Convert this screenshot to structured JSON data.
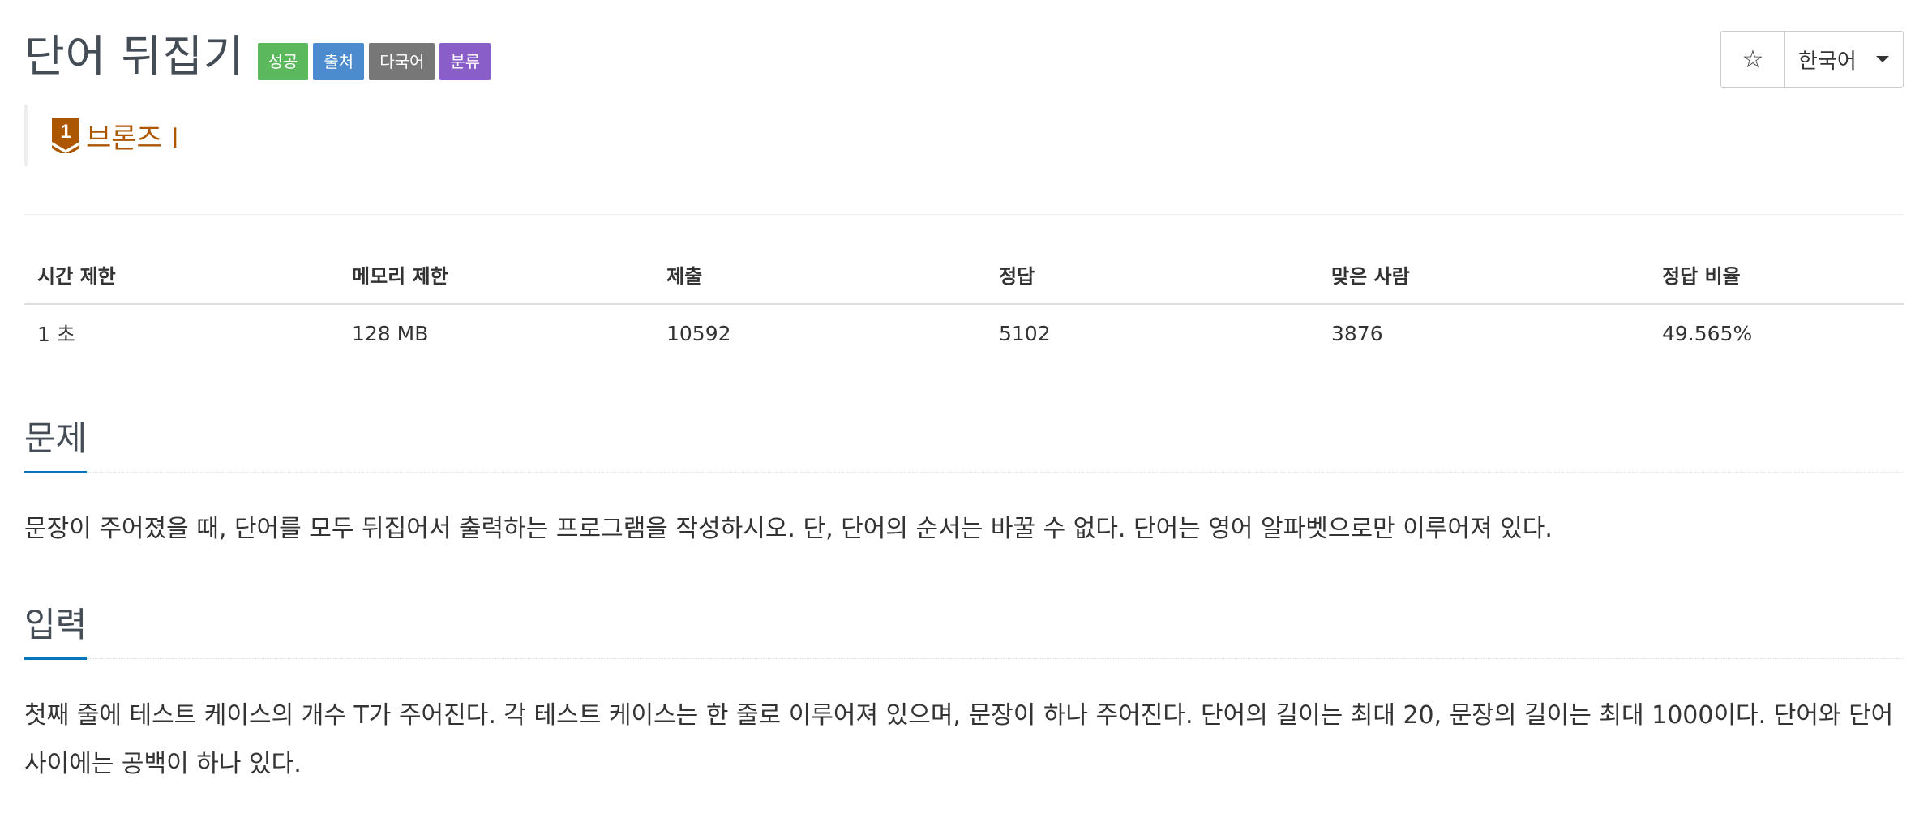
{
  "problem": {
    "title": "단어 뒤집기",
    "labels": [
      {
        "text": "성공",
        "color": "#5cb85c"
      },
      {
        "text": "출처",
        "color": "#4b8bce"
      },
      {
        "text": "다국어",
        "color": "#777777"
      },
      {
        "text": "분류",
        "color": "#8a5ec8"
      }
    ],
    "tier": {
      "level": "1",
      "name": "브론즈 I",
      "color": "#ad5600"
    }
  },
  "toolbar": {
    "star_glyph": "☆",
    "language": "한국어"
  },
  "info_table": {
    "headers": [
      "시간 제한",
      "메모리 제한",
      "제출",
      "정답",
      "맞은 사람",
      "정답 비율"
    ],
    "values": [
      "1 초",
      "128 MB",
      "10592",
      "5102",
      "3876",
      "49.565%"
    ]
  },
  "sections": {
    "description": {
      "title": "문제",
      "body": "문장이 주어졌을 때, 단어를 모두 뒤집어서 출력하는 프로그램을 작성하시오. 단, 단어의 순서는 바꿀 수 없다. 단어는 영어 알파벳으로만 이루어져 있다."
    },
    "input": {
      "title": "입력",
      "body": "첫째 줄에 테스트 케이스의 개수 T가 주어진다. 각 테스트 케이스는 한 줄로 이루어져 있으며, 문장이 하나 주어진다. 단어의 길이는 최대 20, 문장의 길이는 최대 1000이다. 단어와 단어 사이에는 공백이 하나 있다."
    }
  }
}
